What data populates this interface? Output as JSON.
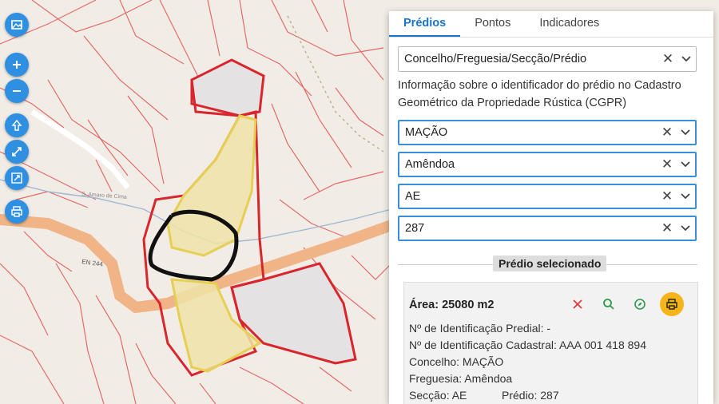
{
  "map": {
    "labels": {
      "road": "EN 244",
      "place": "S. Amaro de Cima"
    },
    "buttons": [
      "image-icon",
      "zoom-in-icon",
      "zoom-out-icon",
      "home-icon",
      "fullscreen-icon",
      "extent-icon",
      "print-icon"
    ]
  },
  "panel": {
    "tabs": [
      "Prédios",
      "Pontos",
      "Indicadores"
    ],
    "active_tab": "Prédios",
    "search_type": "Concelho/Freguesia/Secção/Prédio",
    "info_text": "Informação sobre o identificador do prédio no Cadastro Geométrico da Propriedade Rústica (CGPR)",
    "concelho": "MAÇÃO",
    "freguesia": "Amêndoa",
    "seccao": "AE",
    "predio": "287",
    "clear_glyph": "✕",
    "section_title": "Prédio selecionado",
    "selected": {
      "area": "Área: 25080 m2",
      "id_predial": "Nº de Identificação Predial: -",
      "id_cadastral": "Nº de Identificação Cadastral: AAA 001 418 894",
      "concelho": "Concelho: MAÇÃO",
      "freguesia": "Freguesia: Amêndoa",
      "seccao": "Secção: AE",
      "predio": "Prédio: 287"
    }
  },
  "colors": {
    "accent": "#1a73c9",
    "parcel_line": "#d9262c",
    "selected_fill": "#efe3a8",
    "road": "#f2b88a",
    "print_btn": "#f5b51a"
  }
}
